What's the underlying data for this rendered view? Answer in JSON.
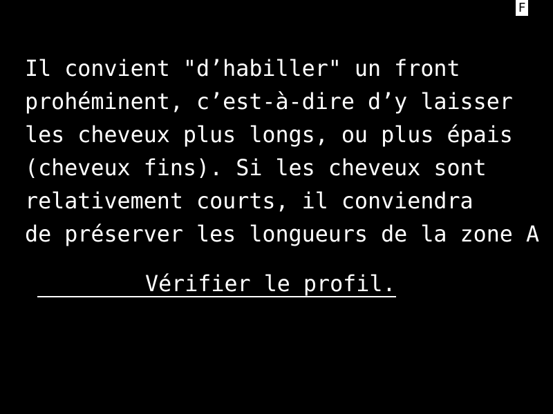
{
  "status": {
    "indicator": "F"
  },
  "message": {
    "lines": [
      "Il convient \"d’habiller\" un front",
      "prohéminent, c’est-à-dire d’y laisser",
      "les cheveux plus longs, ou plus épais",
      "(cheveux fins). Si les cheveux sont",
      "relativement courts, il conviendra",
      "de préserver les longueurs de la zone A"
    ]
  },
  "action": {
    "label": "Vérifier le profil."
  }
}
